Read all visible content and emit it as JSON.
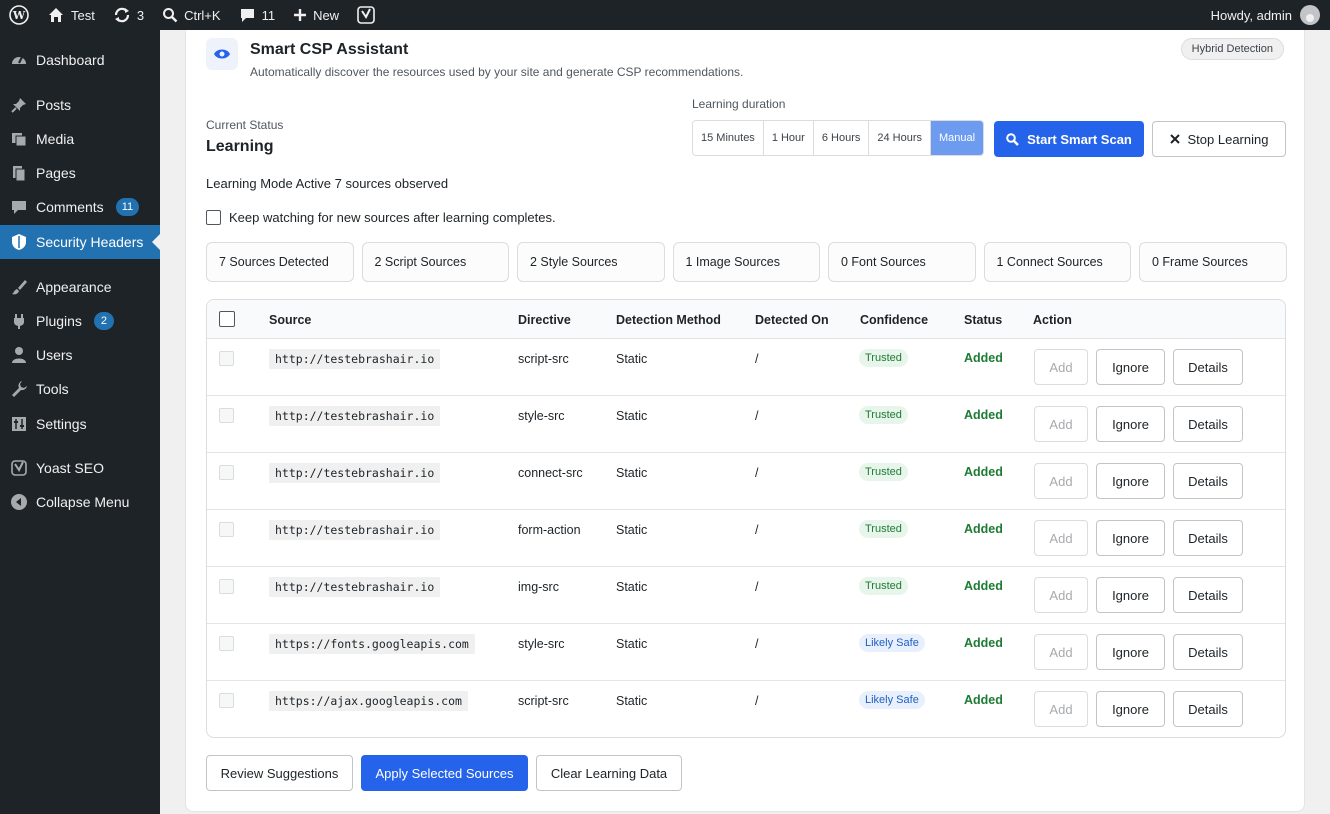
{
  "admin_bar": {
    "site_name": "Test",
    "updates": "3",
    "search_shortcut": "Ctrl+K",
    "comments": "11",
    "new_label": "New",
    "greeting": "Howdy, admin"
  },
  "sidebar": {
    "items": [
      {
        "label": "Dashboard",
        "icon": "dashboard-icon"
      },
      {
        "label": "Posts",
        "icon": "pin-icon"
      },
      {
        "label": "Media",
        "icon": "media-icon"
      },
      {
        "label": "Pages",
        "icon": "pages-icon"
      },
      {
        "label": "Comments",
        "icon": "comment-icon",
        "count": "11"
      },
      {
        "label": "Security Headers",
        "icon": "shield-icon",
        "active": true
      },
      {
        "label": "Appearance",
        "icon": "brush-icon"
      },
      {
        "label": "Plugins",
        "icon": "plug-icon",
        "count": "2"
      },
      {
        "label": "Users",
        "icon": "user-icon"
      },
      {
        "label": "Tools",
        "icon": "wrench-icon"
      },
      {
        "label": "Settings",
        "icon": "settings-icon"
      },
      {
        "label": "Yoast SEO",
        "icon": "yoast-icon"
      },
      {
        "label": "Collapse Menu",
        "icon": "collapse-icon"
      }
    ]
  },
  "header": {
    "title": "Smart CSP Assistant",
    "subtitle": "Automatically discover the resources used by your site and generate CSP recommendations.",
    "badge": "Hybrid Detection"
  },
  "status": {
    "label": "Current Status",
    "value": "Learning"
  },
  "duration": {
    "label": "Learning duration",
    "options": [
      "15 Minutes",
      "1 Hour",
      "6 Hours",
      "24 Hours",
      "Manual"
    ],
    "selected": "Manual"
  },
  "actions": {
    "start_scan": "Start Smart Scan",
    "stop_learning": "Stop Learning"
  },
  "mode_text": "Learning Mode Active 7 sources observed",
  "keep_watching": "Keep watching for new sources after learning completes.",
  "stats": [
    "7 Sources Detected",
    "2 Script Sources",
    "2 Style Sources",
    "1 Image Sources",
    "0 Font Sources",
    "1 Connect Sources",
    "0 Frame Sources"
  ],
  "table": {
    "columns": [
      "Source",
      "Directive",
      "Detection Method",
      "Detected On",
      "Confidence",
      "Status",
      "Action"
    ],
    "rows": [
      {
        "source": "http://testebrashair.io",
        "directive": "script-src",
        "method": "Static",
        "detected_on": "/",
        "confidence": "Trusted",
        "status": "Added"
      },
      {
        "source": "http://testebrashair.io",
        "directive": "style-src",
        "method": "Static",
        "detected_on": "/",
        "confidence": "Trusted",
        "status": "Added"
      },
      {
        "source": "http://testebrashair.io",
        "directive": "connect-src",
        "method": "Static",
        "detected_on": "/",
        "confidence": "Trusted",
        "status": "Added"
      },
      {
        "source": "http://testebrashair.io",
        "directive": "form-action",
        "method": "Static",
        "detected_on": "/",
        "confidence": "Trusted",
        "status": "Added"
      },
      {
        "source": "http://testebrashair.io",
        "directive": "img-src",
        "method": "Static",
        "detected_on": "/",
        "confidence": "Trusted",
        "status": "Added"
      },
      {
        "source": "https://fonts.googleapis.com",
        "directive": "style-src",
        "method": "Static",
        "detected_on": "/",
        "confidence": "Likely Safe",
        "status": "Added"
      },
      {
        "source": "https://ajax.googleapis.com",
        "directive": "script-src",
        "method": "Static",
        "detected_on": "/",
        "confidence": "Likely Safe",
        "status": "Added"
      }
    ],
    "row_actions": {
      "add": "Add",
      "ignore": "Ignore",
      "details": "Details"
    }
  },
  "footer": {
    "review": "Review Suggestions",
    "apply": "Apply Selected Sources",
    "clear": "Clear Learning Data"
  },
  "colors": {
    "admin_dark": "#1d2327",
    "accent": "#2563eb",
    "active_menu": "#2271b1",
    "added_green": "#1e7b34"
  }
}
